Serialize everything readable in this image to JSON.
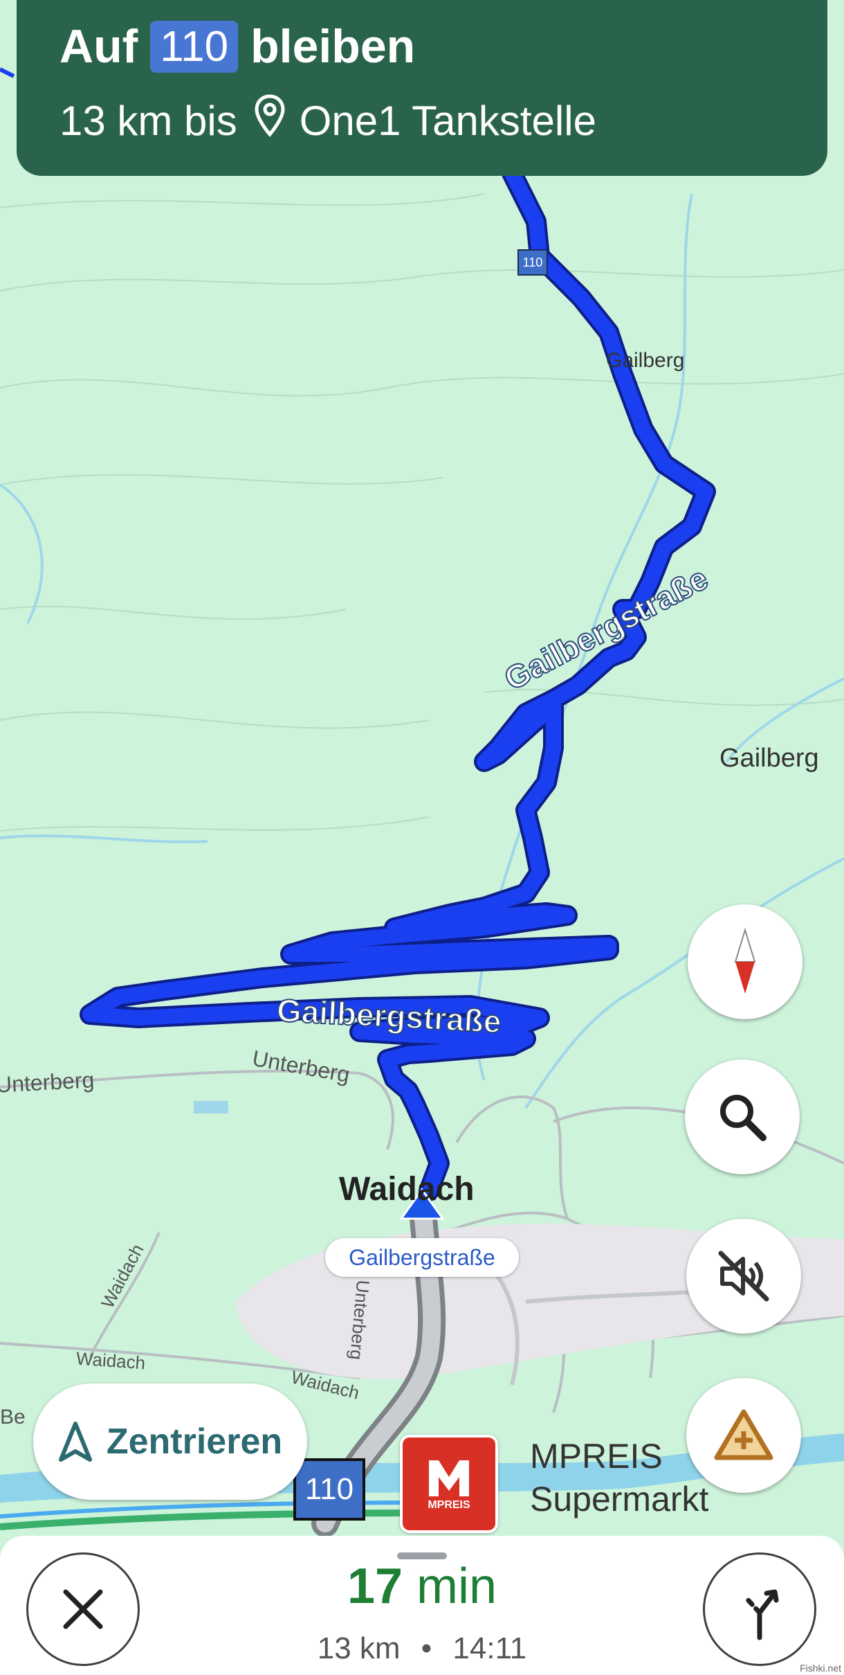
{
  "banner": {
    "prefix": "Auf",
    "road": "110",
    "suffix": "bleiben",
    "distance": "13 km bis",
    "destination": "One1 Tankstelle"
  },
  "map_labels": {
    "gailberg_small": "Gailberg",
    "gailberg_right": "Gailberg",
    "road_upper": "Gailbergstraße",
    "road_lower": "Gailbergstraße",
    "unterberg_left": "Unterberg",
    "unterberg_mid": "Unterberg",
    "waidach_town": "Waidach",
    "waidach_road1": "Waidach",
    "waidach_road2": "Waidach",
    "waidach_road3": "Waidach",
    "unterberg_vertical": "Unterberg",
    "be": "Be",
    "current_road": "Gailbergstraße",
    "road_shield_small": "110",
    "road_shield_big": "110",
    "poi_logo_text": "MPREIS",
    "poi_name_1": "MPREIS",
    "poi_name_2": "Supermarkt"
  },
  "controls": {
    "center_label": "Zentrieren",
    "compass": "compass-icon",
    "search": "search-icon",
    "mute": "sound-off-icon",
    "report": "report-incident-icon"
  },
  "trip": {
    "eta_value": "17",
    "eta_unit": "min",
    "distance": "13 km",
    "separator": "•",
    "arrival": "14:11"
  },
  "watermark": "Fishki.net",
  "colors": {
    "banner": "#2a634b",
    "route": "#1a3ff0",
    "map_bg": "#cdf3db",
    "eta": "#1e7e34"
  }
}
